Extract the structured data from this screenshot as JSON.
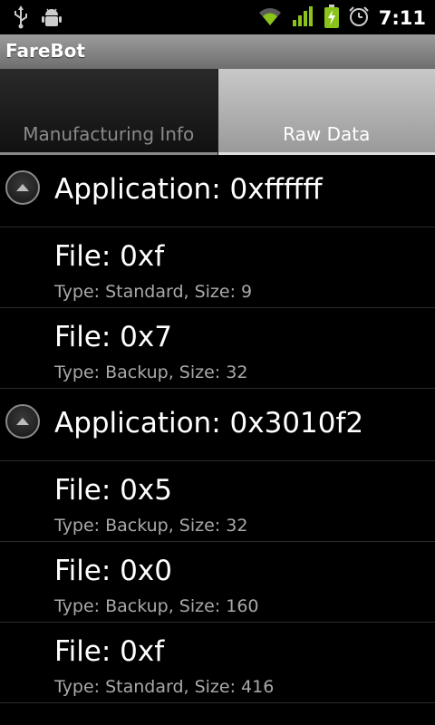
{
  "status_bar": {
    "icons": [
      "usb-icon",
      "android-debug-icon",
      "wifi-icon",
      "signal-icon",
      "battery-charging-icon",
      "alarm-icon"
    ],
    "time": "7:11",
    "accent_color": "#8ac31a"
  },
  "app": {
    "title": "FareBot"
  },
  "tabs": [
    {
      "label": "Manufacturing Info",
      "selected": false
    },
    {
      "label": "Raw Data",
      "selected": true
    }
  ],
  "applications": [
    {
      "label": "Application: 0xffffff",
      "expanded": true,
      "files": [
        {
          "title": "File: 0xf",
          "details": "Type: Standard, Size: 9"
        },
        {
          "title": "File: 0x7",
          "details": "Type: Backup, Size: 32"
        }
      ]
    },
    {
      "label": "Application: 0x3010f2",
      "expanded": true,
      "files": [
        {
          "title": "File: 0x5",
          "details": "Type: Backup, Size: 32"
        },
        {
          "title": "File: 0x0",
          "details": "Type: Backup, Size: 160"
        },
        {
          "title": "File: 0xf",
          "details": "Type: Standard, Size: 416"
        }
      ]
    }
  ]
}
